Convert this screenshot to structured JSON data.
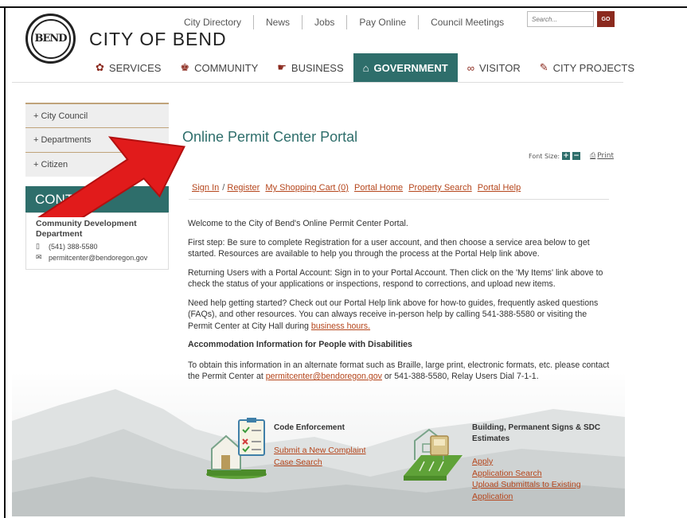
{
  "site": {
    "logo_text": "BEND",
    "title": "CITY OF BEND"
  },
  "utility_nav": [
    "City Directory",
    "News",
    "Jobs",
    "Pay Online",
    "Council Meetings"
  ],
  "search": {
    "placeholder": "Search...",
    "go": "GO"
  },
  "main_nav": [
    {
      "label": "SERVICES",
      "icon": "gear-icon"
    },
    {
      "label": "COMMUNITY",
      "icon": "people-icon"
    },
    {
      "label": "BUSINESS",
      "icon": "handshake-icon"
    },
    {
      "label": "GOVERNMENT",
      "icon": "building-icon",
      "active": true
    },
    {
      "label": "VISITOR",
      "icon": "binoculars-icon"
    },
    {
      "label": "CITY PROJECTS",
      "icon": "tool-icon"
    }
  ],
  "sidebar": {
    "items": [
      "+ City Council",
      "+ Departments",
      "+ Citizen"
    ],
    "contact_heading": "CONTACT",
    "contact_dept": "Community Development Department",
    "phone": "(541) 388-5580",
    "email": "permitcenter@bendoregon.gov"
  },
  "page": {
    "title": "Online Permit Center Portal",
    "font_size_label": "Font Size:",
    "font_plus": "+",
    "font_minus": "−",
    "print": "Print"
  },
  "portal_nav": {
    "sign_in": "Sign In",
    "sep": "/",
    "register": "Register",
    "cart": "My Shopping Cart (0)",
    "home": "Portal Home",
    "property": "Property Search",
    "help": "Portal Help"
  },
  "content": {
    "welcome": "Welcome to the City of Bend's Online Permit Center Portal.",
    "first_step": "First step: Be sure to complete Registration for a user account, and then choose a service area below to get started. Resources are available to help you through the process at the Portal Help link above.",
    "returning": "Returning Users with a Portal Account: Sign in to your Portal Account. Then click on the 'My Items' link above to check the status of your applications or inspections, respond to corrections, and upload new items.",
    "help_pre": "Need help getting started? Check out our Portal Help link above for how-to guides, frequently asked questions (FAQs), and other resources. You can always receive in-person help by calling 541-388-5580 or visiting the Permit Center at City Hall during ",
    "help_link": "business hours.",
    "accommodation_heading": "Accommodation Information for People with Disabilities",
    "alt_pre": "To obtain this information in an alternate format such as Braille, large print, electronic formats, etc. please contact the Permit Center at ",
    "alt_link": "permitcenter@bendoregon.gov",
    "alt_post": " or 541-388-5580, Relay Users Dial 7-1-1."
  },
  "services": {
    "code": {
      "title": "Code Enforcement",
      "links": [
        "Submit a New Complaint",
        "Case Search"
      ]
    },
    "building": {
      "title": "Building, Permanent Signs & SDC Estimates",
      "links": [
        "Apply",
        "Application Search",
        "Upload Submittals to Existing Application"
      ]
    }
  },
  "colors": {
    "accent": "#2e6e6b",
    "link": "#b5451b",
    "go_button": "#8b2a1e",
    "arrow": "#e11b1b"
  }
}
